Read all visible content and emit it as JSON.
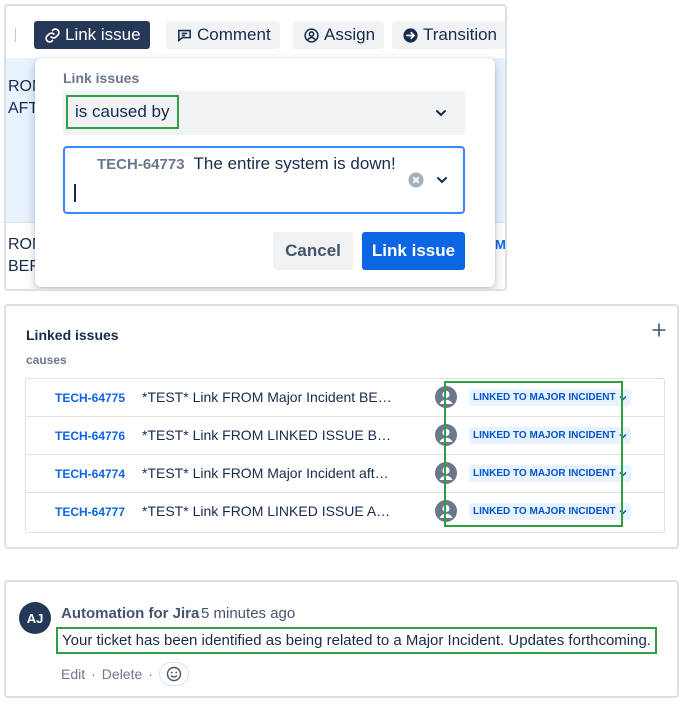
{
  "toolbar": {
    "link_issue": "Link issue",
    "comment": "Comment",
    "assign": "Assign",
    "transition": "Transition"
  },
  "background": {
    "frag1": "ROM",
    "frag2": "AFT",
    "frag3": "ROM",
    "frag4": "BEF",
    "frag_link": "M"
  },
  "link_popup": {
    "title": "Link issues",
    "link_type": "is caused by",
    "selected_issue": {
      "key": "TECH-64773",
      "summary": "The entire system is down!"
    },
    "cancel_label": "Cancel",
    "submit_label": "Link issue"
  },
  "linked_issues": {
    "title": "Linked issues",
    "relation": "causes",
    "rows": [
      {
        "key": "TECH-64775",
        "summary": "*TEST* Link FROM Major Incident BEFO...",
        "status": "LINKED TO MAJOR INCIDENT"
      },
      {
        "key": "TECH-64776",
        "summary": "*TEST* Link FROM LINKED ISSUE BEFO...",
        "status": "LINKED TO MAJOR INCIDENT"
      },
      {
        "key": "TECH-64774",
        "summary": "*TEST* Link FROM Major Incident after ...",
        "status": "LINKED TO MAJOR INCIDENT"
      },
      {
        "key": "TECH-64777",
        "summary": "*TEST* Link FROM LINKED ISSUE AFTE...",
        "status": "LINKED TO MAJOR INCIDENT"
      }
    ]
  },
  "comment": {
    "avatar_initials": "AJ",
    "author": "Automation for Jira",
    "time": "5 minutes ago",
    "body": "Your ticket has been identified as being related to a Major Incident. Updates forthcoming.",
    "edit_label": "Edit",
    "delete_label": "Delete",
    "separator": "·"
  },
  "colors": {
    "primary_blue": "#0c66e4",
    "dark_navy": "#253858",
    "highlight_green": "#2ea043",
    "status_bg": "#e9f2ff"
  },
  "icons": [
    "link-icon",
    "comment-icon",
    "assign-icon",
    "transition-icon",
    "chevron-down-icon",
    "clear-icon",
    "plus-icon",
    "user-avatar-icon",
    "emoji-icon"
  ]
}
